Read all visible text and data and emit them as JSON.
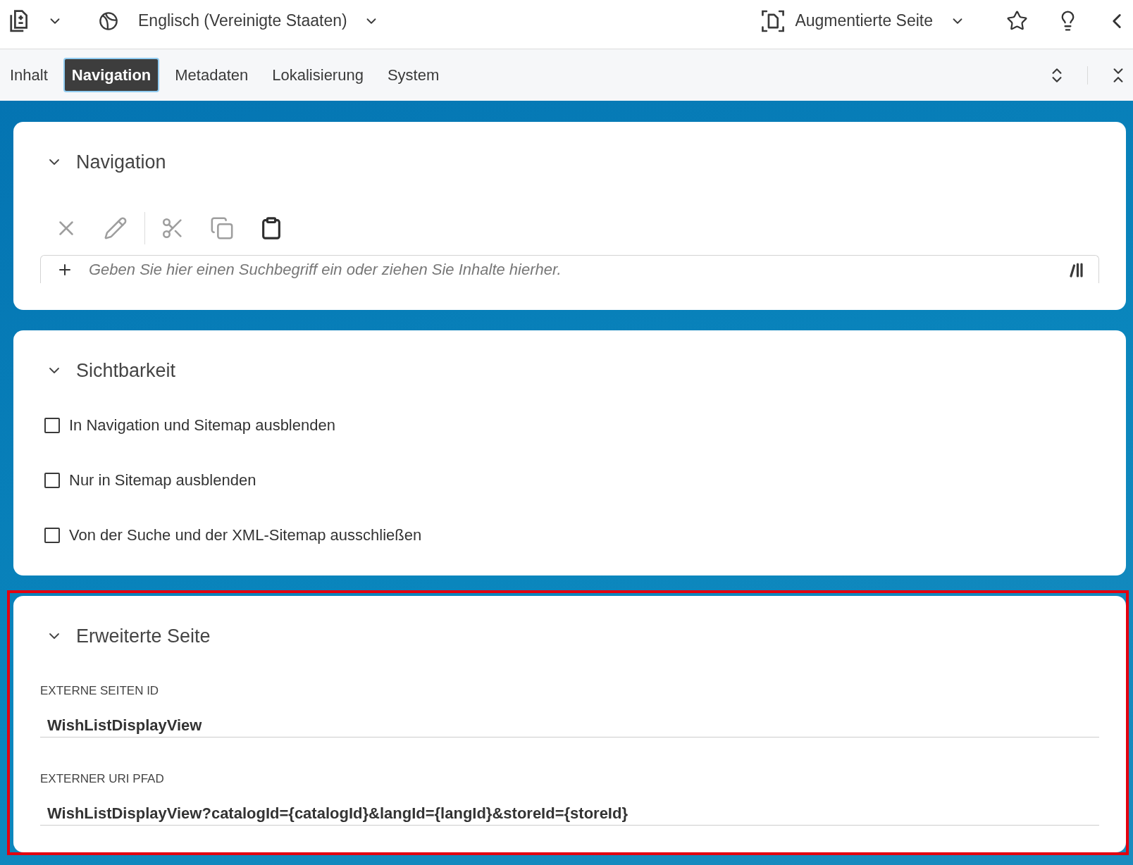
{
  "header": {
    "language": "Englisch (Vereinigte Staaten)",
    "view_mode": "Augmentierte Seite"
  },
  "tabs": [
    {
      "label": "Inhalt",
      "selected": false
    },
    {
      "label": "Navigation",
      "selected": true
    },
    {
      "label": "Metadaten",
      "selected": false
    },
    {
      "label": "Lokalisierung",
      "selected": false
    },
    {
      "label": "System",
      "selected": false
    }
  ],
  "sections": [
    {
      "kind": "picker",
      "title": "Navigation",
      "expanded": true,
      "highlighted": false,
      "actions": [
        {
          "kind": "delete",
          "disabled": true
        },
        {
          "kind": "edit",
          "disabled": true
        },
        {
          "kind": "cut",
          "disabled": true
        },
        {
          "kind": "copy",
          "disabled": true
        },
        {
          "kind": "paste",
          "disabled": false
        }
      ],
      "search": {
        "placeholder": "Geben Sie hier einen Suchbegriff ein oder ziehen Sie Inhalte hierher."
      }
    },
    {
      "kind": "checkboxes",
      "title": "Sichtbarkeit",
      "expanded": true,
      "highlighted": false,
      "options": [
        {
          "label": "In Navigation und Sitemap ausblenden",
          "checked": false
        },
        {
          "label": "Nur in Sitemap ausblenden",
          "checked": false
        },
        {
          "label": "Von der Suche und der XML-Sitemap ausschließen",
          "checked": false
        }
      ]
    },
    {
      "kind": "fields",
      "title": "Erweiterte Seite",
      "expanded": true,
      "highlighted": true,
      "fields": [
        {
          "label": "EXTERNE SEITEN ID",
          "value": "WishListDisplayView"
        },
        {
          "label": "EXTERNER URI PFAD",
          "value": "WishListDisplayView?catalogId={catalogId}&langId={langId}&storeId={storeId}"
        }
      ]
    }
  ]
}
